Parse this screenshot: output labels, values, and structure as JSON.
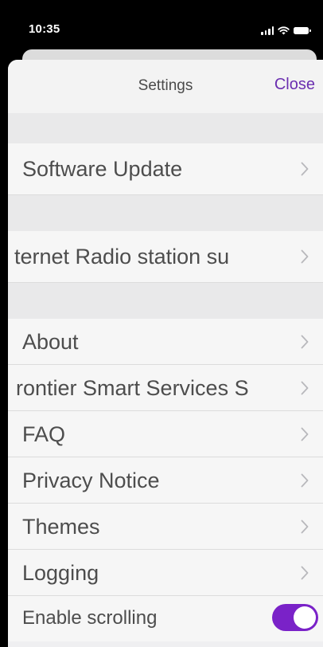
{
  "status_bar": {
    "time": "10:35",
    "icons": [
      "signal-icon",
      "wifi-icon",
      "battery-icon"
    ]
  },
  "nav": {
    "title": "Settings",
    "close_label": "Close"
  },
  "rows": {
    "software_update": "Software Update",
    "internet_radio": "ternet Radio station su",
    "about": "About",
    "frontier": "rontier Smart Services S",
    "faq": "FAQ",
    "privacy": "Privacy Notice",
    "themes": "Themes",
    "logging": "Logging",
    "enable_scrolling": "Enable scrolling"
  },
  "toggle": {
    "enable_scrolling_on": true
  },
  "colors": {
    "accent": "#6b2fb0",
    "toggle_on": "#7a22c8",
    "text": "#4d4d4d",
    "background": "#efeff1"
  }
}
